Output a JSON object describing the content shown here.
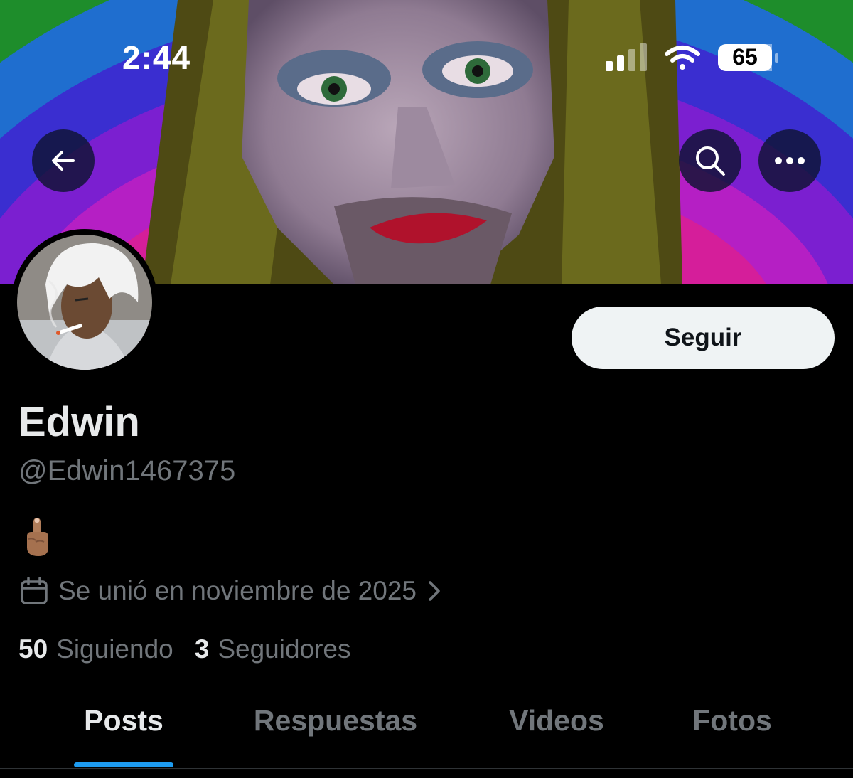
{
  "status_bar": {
    "time": "2:44",
    "battery_level": "65",
    "signal_icon": "cellular-signal-icon",
    "wifi_icon": "wifi-icon",
    "battery_icon": "battery-icon"
  },
  "nav": {
    "back_icon": "arrow-left-icon",
    "search_icon": "search-icon",
    "more_icon": "more-horizontal-icon"
  },
  "profile": {
    "display_name": "Edwin",
    "handle": "@Edwin1467375",
    "bio_emoji": "middle-finger-emoji",
    "joined_text": "Se unió en noviembre de 2025",
    "follow_label": "Seguir",
    "following_count": "50",
    "following_label": "Siguiendo",
    "followers_count": "3",
    "followers_label": "Seguidores"
  },
  "tabs": [
    {
      "label": "Posts",
      "active": true
    },
    {
      "label": "Respuestas",
      "active": false
    },
    {
      "label": "Videos",
      "active": false
    },
    {
      "label": "Fotos",
      "active": false
    }
  ],
  "colors": {
    "background": "#000000",
    "primary_text": "#e7e9ea",
    "secondary_text": "#71767b",
    "accent": "#1d9bf0",
    "follow_button_bg": "#eff3f4"
  }
}
